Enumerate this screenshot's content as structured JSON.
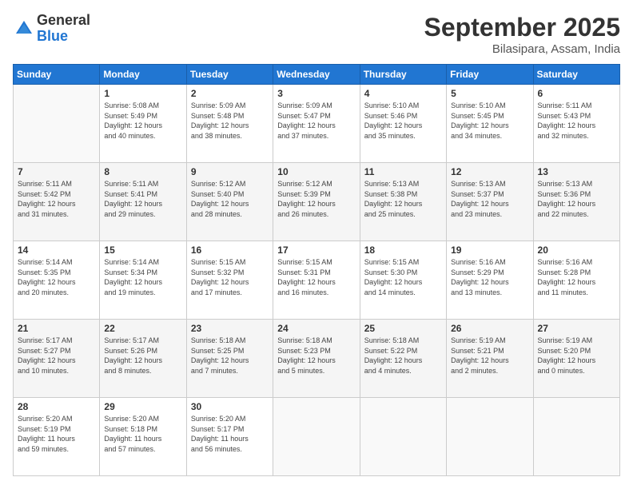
{
  "logo": {
    "general": "General",
    "blue": "Blue"
  },
  "title": "September 2025",
  "location": "Bilasipara, Assam, India",
  "days_of_week": [
    "Sunday",
    "Monday",
    "Tuesday",
    "Wednesday",
    "Thursday",
    "Friday",
    "Saturday"
  ],
  "weeks": [
    [
      {
        "day": "",
        "info": ""
      },
      {
        "day": "1",
        "info": "Sunrise: 5:08 AM\nSunset: 5:49 PM\nDaylight: 12 hours\nand 40 minutes."
      },
      {
        "day": "2",
        "info": "Sunrise: 5:09 AM\nSunset: 5:48 PM\nDaylight: 12 hours\nand 38 minutes."
      },
      {
        "day": "3",
        "info": "Sunrise: 5:09 AM\nSunset: 5:47 PM\nDaylight: 12 hours\nand 37 minutes."
      },
      {
        "day": "4",
        "info": "Sunrise: 5:10 AM\nSunset: 5:46 PM\nDaylight: 12 hours\nand 35 minutes."
      },
      {
        "day": "5",
        "info": "Sunrise: 5:10 AM\nSunset: 5:45 PM\nDaylight: 12 hours\nand 34 minutes."
      },
      {
        "day": "6",
        "info": "Sunrise: 5:11 AM\nSunset: 5:43 PM\nDaylight: 12 hours\nand 32 minutes."
      }
    ],
    [
      {
        "day": "7",
        "info": "Sunrise: 5:11 AM\nSunset: 5:42 PM\nDaylight: 12 hours\nand 31 minutes."
      },
      {
        "day": "8",
        "info": "Sunrise: 5:11 AM\nSunset: 5:41 PM\nDaylight: 12 hours\nand 29 minutes."
      },
      {
        "day": "9",
        "info": "Sunrise: 5:12 AM\nSunset: 5:40 PM\nDaylight: 12 hours\nand 28 minutes."
      },
      {
        "day": "10",
        "info": "Sunrise: 5:12 AM\nSunset: 5:39 PM\nDaylight: 12 hours\nand 26 minutes."
      },
      {
        "day": "11",
        "info": "Sunrise: 5:13 AM\nSunset: 5:38 PM\nDaylight: 12 hours\nand 25 minutes."
      },
      {
        "day": "12",
        "info": "Sunrise: 5:13 AM\nSunset: 5:37 PM\nDaylight: 12 hours\nand 23 minutes."
      },
      {
        "day": "13",
        "info": "Sunrise: 5:13 AM\nSunset: 5:36 PM\nDaylight: 12 hours\nand 22 minutes."
      }
    ],
    [
      {
        "day": "14",
        "info": "Sunrise: 5:14 AM\nSunset: 5:35 PM\nDaylight: 12 hours\nand 20 minutes."
      },
      {
        "day": "15",
        "info": "Sunrise: 5:14 AM\nSunset: 5:34 PM\nDaylight: 12 hours\nand 19 minutes."
      },
      {
        "day": "16",
        "info": "Sunrise: 5:15 AM\nSunset: 5:32 PM\nDaylight: 12 hours\nand 17 minutes."
      },
      {
        "day": "17",
        "info": "Sunrise: 5:15 AM\nSunset: 5:31 PM\nDaylight: 12 hours\nand 16 minutes."
      },
      {
        "day": "18",
        "info": "Sunrise: 5:15 AM\nSunset: 5:30 PM\nDaylight: 12 hours\nand 14 minutes."
      },
      {
        "day": "19",
        "info": "Sunrise: 5:16 AM\nSunset: 5:29 PM\nDaylight: 12 hours\nand 13 minutes."
      },
      {
        "day": "20",
        "info": "Sunrise: 5:16 AM\nSunset: 5:28 PM\nDaylight: 12 hours\nand 11 minutes."
      }
    ],
    [
      {
        "day": "21",
        "info": "Sunrise: 5:17 AM\nSunset: 5:27 PM\nDaylight: 12 hours\nand 10 minutes."
      },
      {
        "day": "22",
        "info": "Sunrise: 5:17 AM\nSunset: 5:26 PM\nDaylight: 12 hours\nand 8 minutes."
      },
      {
        "day": "23",
        "info": "Sunrise: 5:18 AM\nSunset: 5:25 PM\nDaylight: 12 hours\nand 7 minutes."
      },
      {
        "day": "24",
        "info": "Sunrise: 5:18 AM\nSunset: 5:23 PM\nDaylight: 12 hours\nand 5 minutes."
      },
      {
        "day": "25",
        "info": "Sunrise: 5:18 AM\nSunset: 5:22 PM\nDaylight: 12 hours\nand 4 minutes."
      },
      {
        "day": "26",
        "info": "Sunrise: 5:19 AM\nSunset: 5:21 PM\nDaylight: 12 hours\nand 2 minutes."
      },
      {
        "day": "27",
        "info": "Sunrise: 5:19 AM\nSunset: 5:20 PM\nDaylight: 12 hours\nand 0 minutes."
      }
    ],
    [
      {
        "day": "28",
        "info": "Sunrise: 5:20 AM\nSunset: 5:19 PM\nDaylight: 11 hours\nand 59 minutes."
      },
      {
        "day": "29",
        "info": "Sunrise: 5:20 AM\nSunset: 5:18 PM\nDaylight: 11 hours\nand 57 minutes."
      },
      {
        "day": "30",
        "info": "Sunrise: 5:20 AM\nSunset: 5:17 PM\nDaylight: 11 hours\nand 56 minutes."
      },
      {
        "day": "",
        "info": ""
      },
      {
        "day": "",
        "info": ""
      },
      {
        "day": "",
        "info": ""
      },
      {
        "day": "",
        "info": ""
      }
    ]
  ]
}
